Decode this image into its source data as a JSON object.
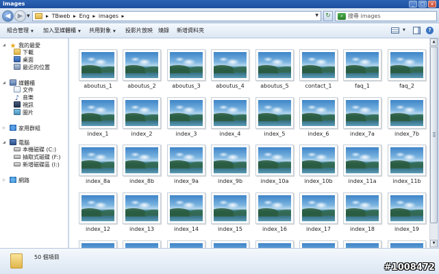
{
  "window": {
    "title": "images"
  },
  "address": {
    "crumbs": [
      "TBweb",
      "Eng",
      "images"
    ],
    "search_placeholder": "搜尋 images"
  },
  "toolbar": {
    "items": [
      {
        "label": "組合管理",
        "has_dropdown": true
      },
      {
        "label": "加入至媒體櫃",
        "has_dropdown": true
      },
      {
        "label": "共用對象",
        "has_dropdown": true
      },
      {
        "label": "投影片放映",
        "has_dropdown": false
      },
      {
        "label": "燒錄",
        "has_dropdown": false
      },
      {
        "label": "新增資料夾",
        "has_dropdown": false
      }
    ]
  },
  "nav": {
    "favorites": {
      "label": "我的最愛",
      "items": [
        "下載",
        "桌面",
        "最近的位置"
      ]
    },
    "libraries": {
      "label": "媒體櫃",
      "items": [
        "文件",
        "音樂",
        "視訊",
        "圖片"
      ]
    },
    "homegroup": {
      "label": "家用群組"
    },
    "computer": {
      "label": "電腦",
      "items": [
        "本機磁碟 (C:)",
        "抽取式磁碟 (F:)",
        "新增磁碟區 (I:)"
      ]
    },
    "network": {
      "label": "網路"
    }
  },
  "files": [
    "aboutus_1",
    "aboutus_2",
    "aboutus_3",
    "aboutus_4",
    "aboutus_5",
    "contact_1",
    "faq_1",
    "faq_2",
    "index_1",
    "index_2",
    "index_3",
    "index_4",
    "index_5",
    "index_6",
    "index_7a",
    "index_7b",
    "index_8a",
    "index_8b",
    "index_9a",
    "index_9b",
    "index_10a",
    "index_10b",
    "index_11a",
    "index_11b",
    "index_12",
    "index_13",
    "index_14",
    "index_15",
    "index_16",
    "index_17",
    "index_18",
    "index_19",
    "",
    "",
    "",
    "",
    "",
    "",
    "",
    ""
  ],
  "details": {
    "count": "50 個項目"
  },
  "watermark": "#1008472"
}
